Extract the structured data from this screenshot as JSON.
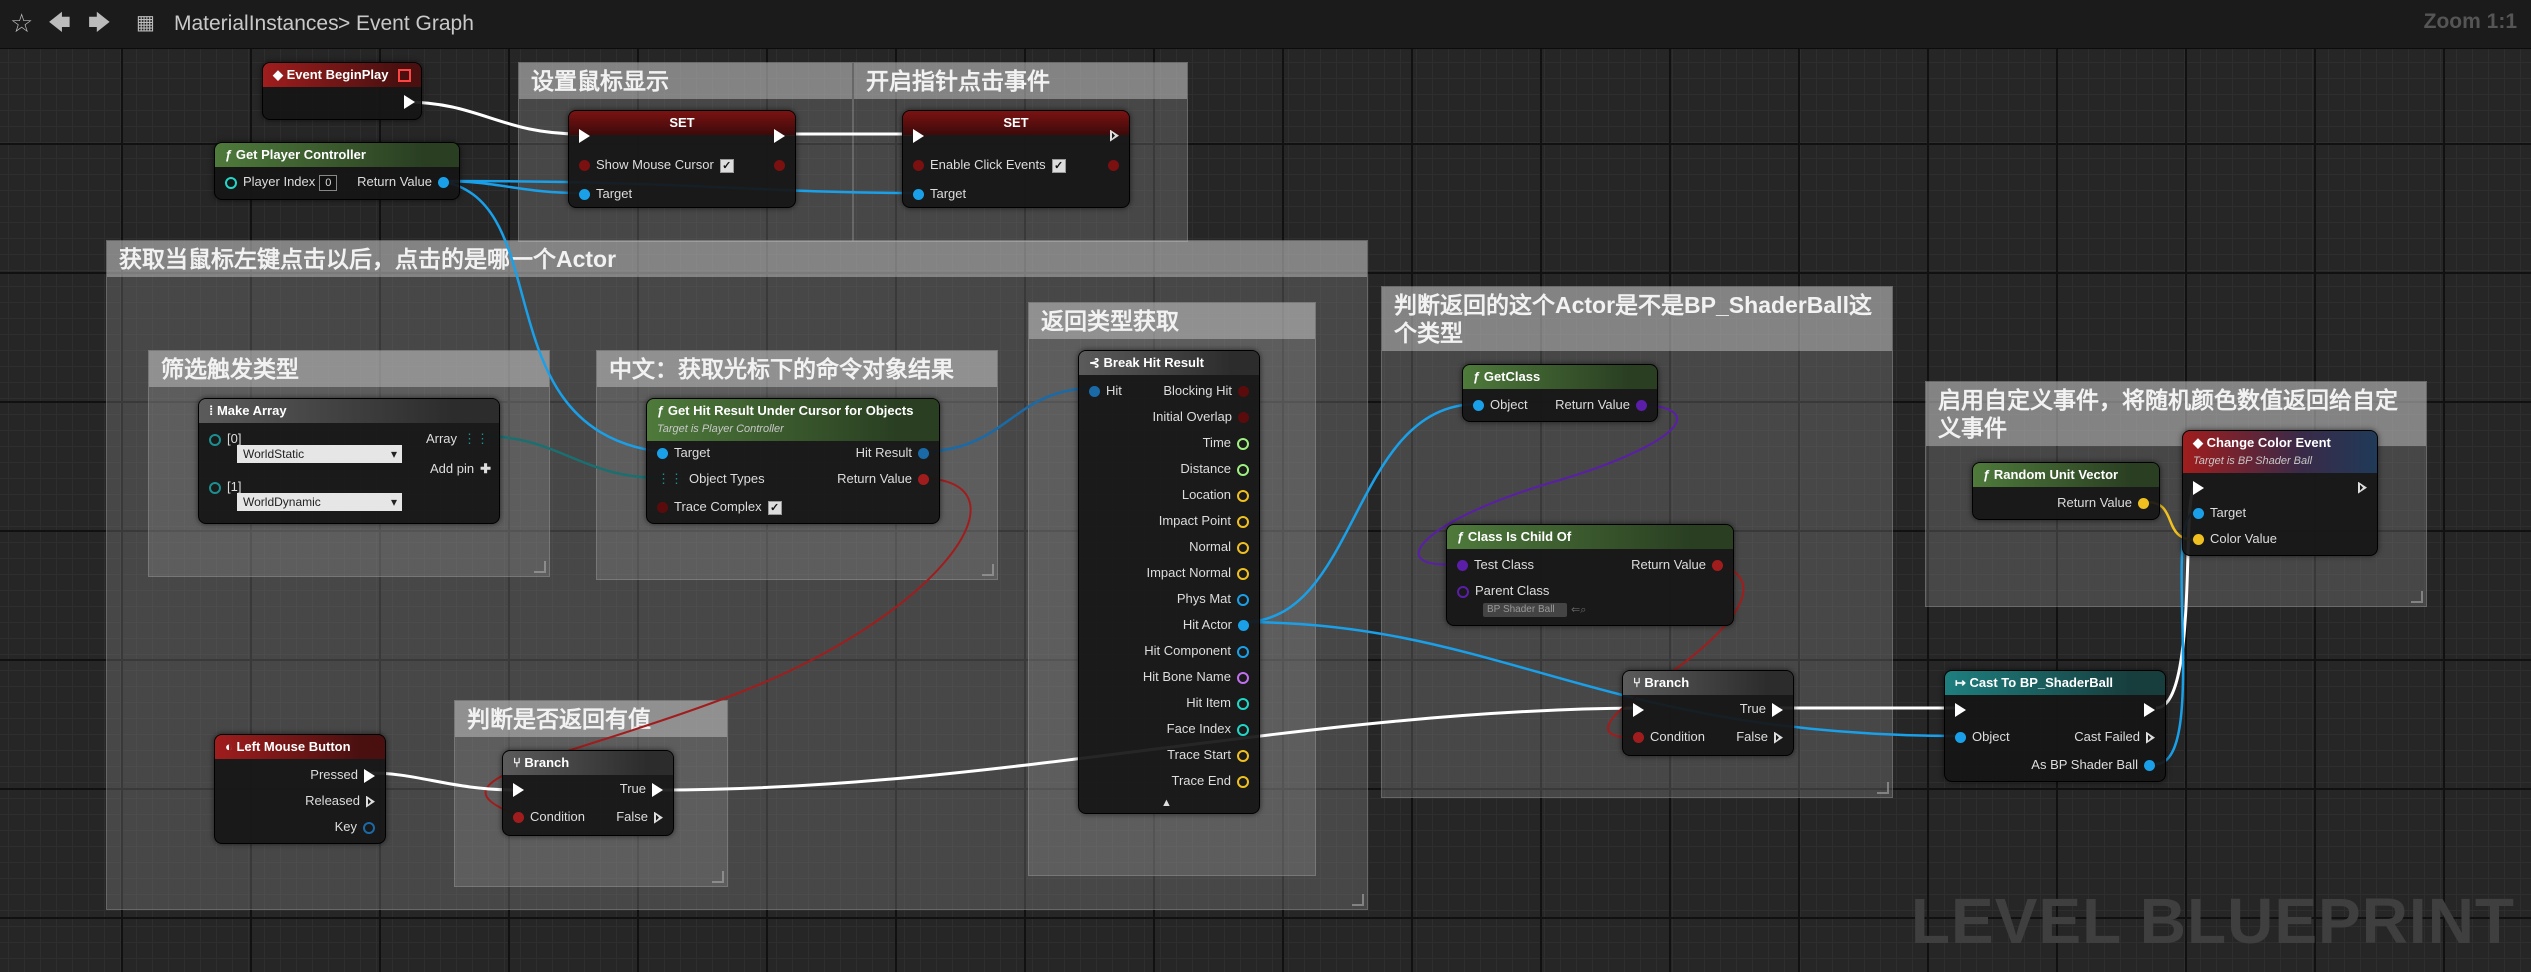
{
  "toolbar": {
    "breadcrumb": [
      "MaterialInstances",
      "Event Graph"
    ],
    "separator": ">",
    "zoom": "Zoom 1:1"
  },
  "watermark": "LEVEL BLUEPRINT",
  "comments": {
    "show_cursor": "设置鼠标显示",
    "click_events": "开启指针点击事件",
    "get_actor": "获取当鼠标左键点击以后，点击的是哪一个Actor",
    "filter": "筛选触发类型",
    "chinese": "中文：获取光标下的命令对象结果",
    "return_type": "返回类型获取",
    "is_shaderball": "判断返回的这个Actor是不是BP_ShaderBall这个类型",
    "has_value": "判断是否返回有值",
    "custom_event": "启用自定义事件，将随机颜色数值返回给自定义事件"
  },
  "nodes": {
    "begin_play": {
      "title": "Event BeginPlay"
    },
    "get_pc": {
      "title": "Get Player Controller",
      "player_index": "Player Index",
      "index_value": "0",
      "return": "Return Value"
    },
    "set1": {
      "title": "SET",
      "field": "Show Mouse Cursor",
      "target": "Target"
    },
    "set2": {
      "title": "SET",
      "field": "Enable Click Events",
      "target": "Target"
    },
    "make_array": {
      "title": "Make Array",
      "idx0": "[0]",
      "val0": "WorldStatic",
      "idx1": "[1]",
      "val1": "WorldDynamic",
      "array": "Array",
      "add_pin": "Add pin"
    },
    "get_hit": {
      "title": "Get Hit Result Under Cursor for Objects",
      "subtitle": "Target is Player Controller",
      "target": "Target",
      "object_types": "Object Types",
      "trace_complex": "Trace Complex",
      "hit_result": "Hit Result",
      "return": "Return Value"
    },
    "break_hit": {
      "title": "Break Hit Result",
      "hit": "Hit",
      "pins": [
        "Blocking Hit",
        "Initial Overlap",
        "Time",
        "Distance",
        "Location",
        "Impact Point",
        "Normal",
        "Impact Normal",
        "Phys Mat",
        "Hit Actor",
        "Hit Component",
        "Hit Bone Name",
        "Hit Item",
        "Face Index",
        "Trace Start",
        "Trace End"
      ]
    },
    "get_class": {
      "title": "GetClass",
      "object": "Object",
      "return": "Return Value"
    },
    "is_child": {
      "title": "Class Is Child Of",
      "test_class": "Test Class",
      "parent_class": "Parent Class",
      "parent_value": "BP Shader Ball",
      "return": "Return Value"
    },
    "branch_mid": {
      "title": "Branch",
      "condition": "Condition",
      "true": "True",
      "false": "False"
    },
    "left_mouse": {
      "title": "Left Mouse Button",
      "pressed": "Pressed",
      "released": "Released",
      "key": "Key"
    },
    "branch_low": {
      "title": "Branch",
      "condition": "Condition",
      "true": "True",
      "false": "False"
    },
    "random_vec": {
      "title": "Random Unit Vector",
      "return": "Return Value"
    },
    "change_color": {
      "title": "Change Color Event",
      "subtitle": "Target is BP Shader Ball",
      "target": "Target",
      "color": "Color Value"
    },
    "cast": {
      "title": "Cast To BP_ShaderBall",
      "object": "Object",
      "cast_failed": "Cast Failed",
      "as_ball": "As BP Shader Ball"
    }
  },
  "colors": {
    "exec": "#ffffff",
    "object": "#1aa0e8",
    "bool": "#a11d1d",
    "struct": "#1a6aa8",
    "class": "#5a1ea8",
    "vector": "#f0c020",
    "float": "#9ff080",
    "enum": "#1a7070"
  }
}
